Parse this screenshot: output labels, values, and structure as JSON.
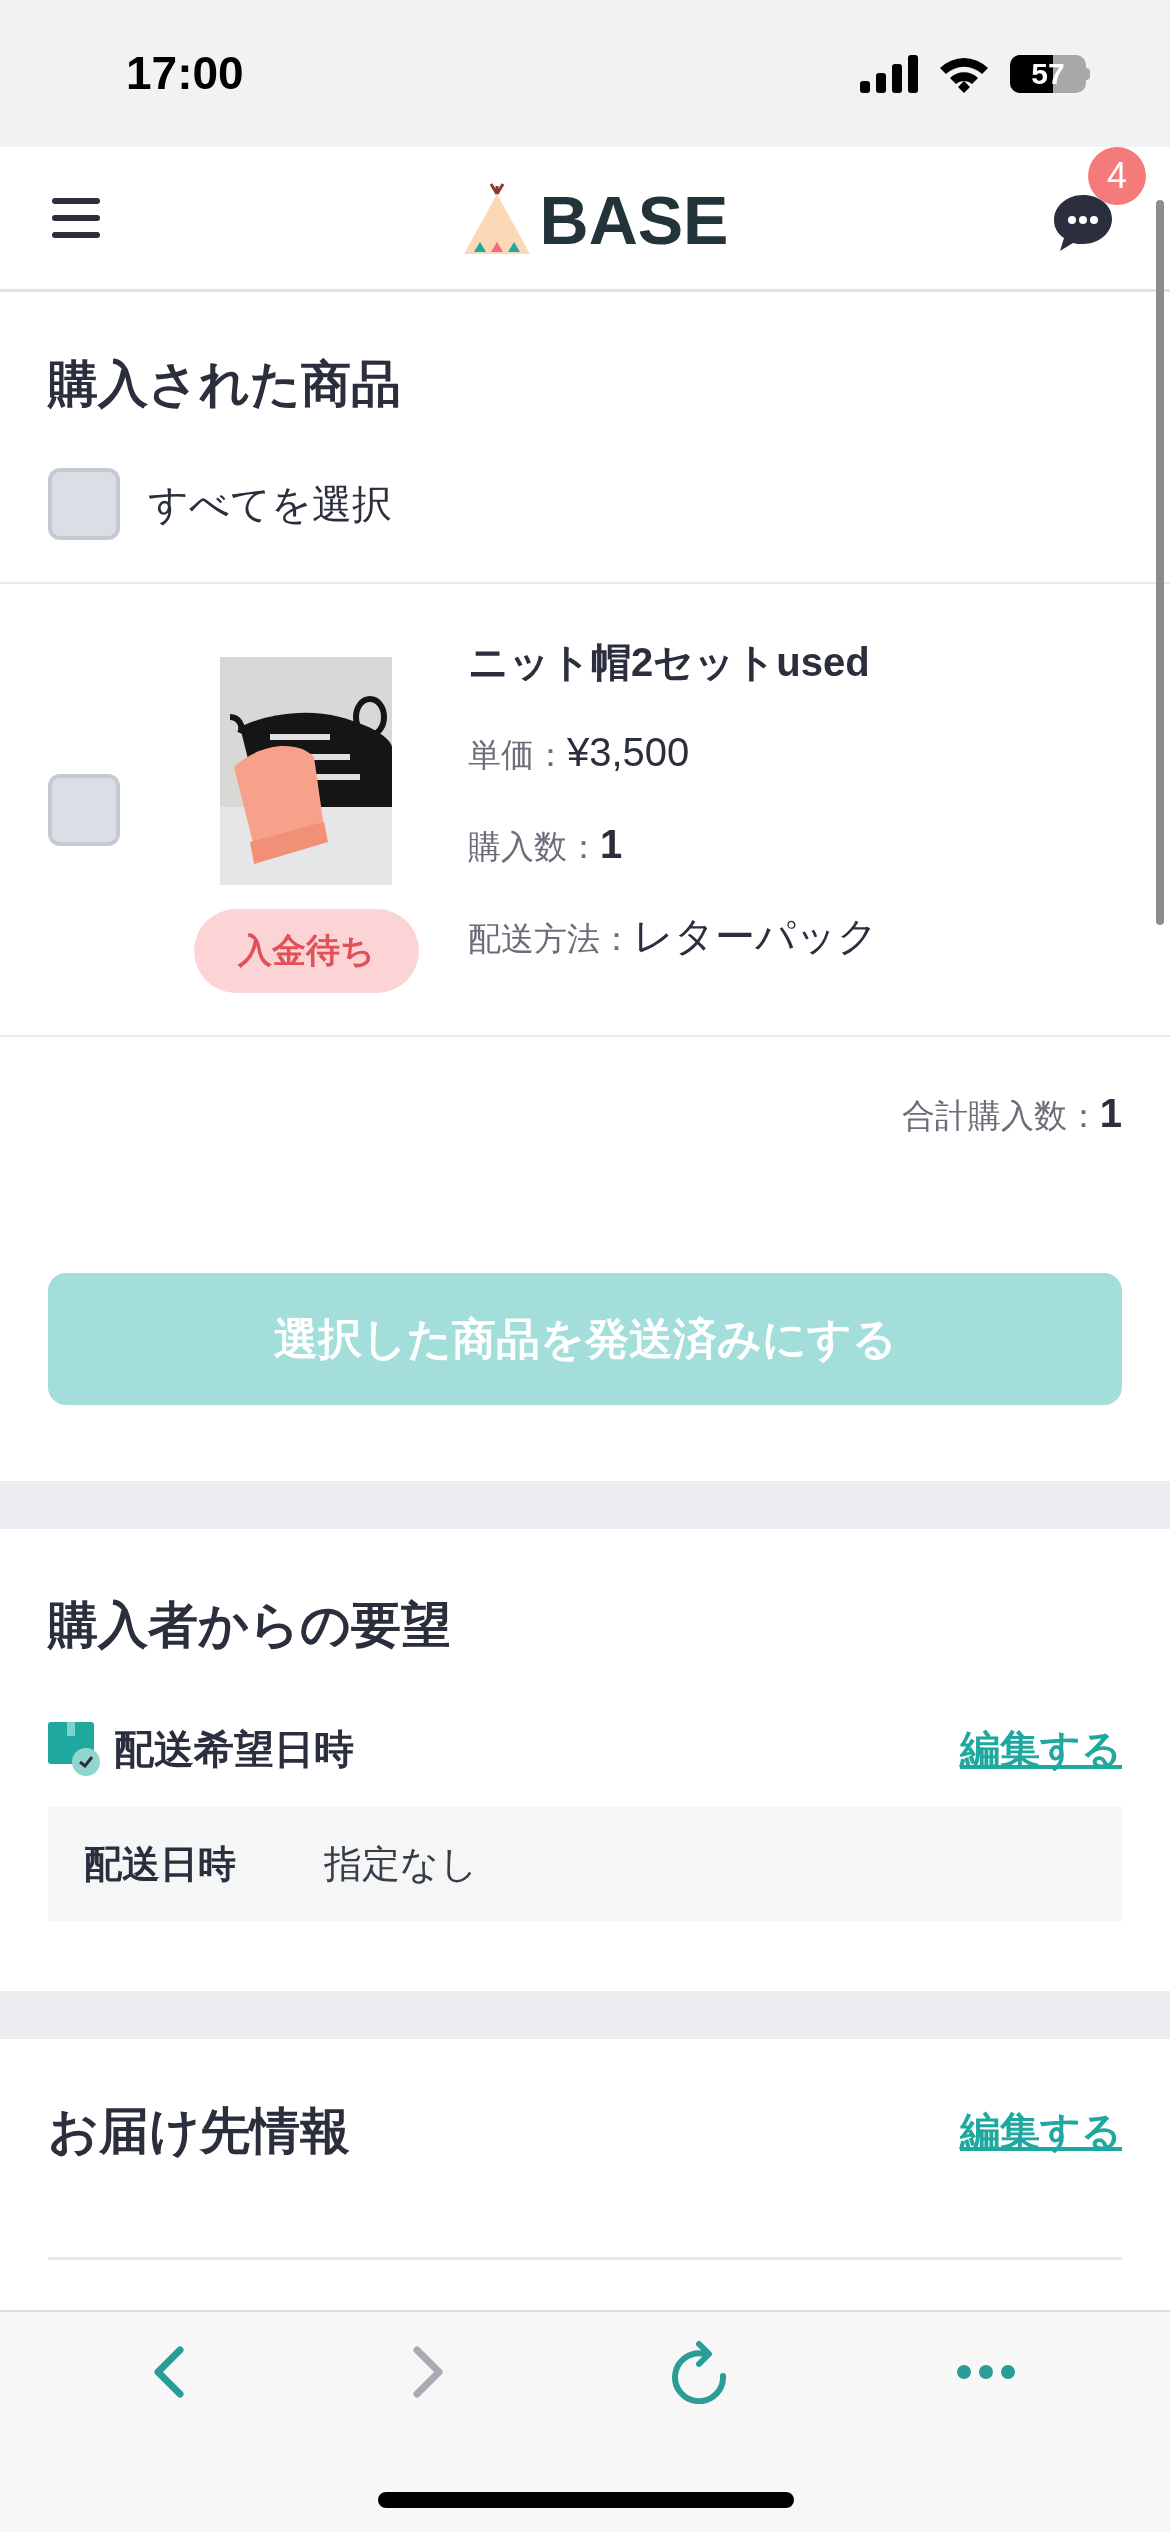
{
  "status_bar": {
    "time": "17:00",
    "battery": "57"
  },
  "header": {
    "logo": "BASE",
    "unread_badge": "4"
  },
  "purchased": {
    "title": "購入された商品",
    "select_all": {
      "label": "すべてを選択",
      "checked": false
    },
    "items": [
      {
        "checked": false,
        "status": "入金待ち",
        "name": "ニット帽2セットused",
        "fields": [
          {
            "label": "単価：",
            "value": "¥3,500",
            "bold": false
          },
          {
            "label": "購入数：",
            "value": "1",
            "bold": true
          },
          {
            "label": "配送方法：",
            "value": "レターパック",
            "bold": false
          }
        ]
      }
    ],
    "total": {
      "label": "合計購入数：",
      "value": "1"
    },
    "ship_button": {
      "label": "選択した商品を発送済みにする",
      "disabled": true
    }
  },
  "requests": {
    "title": "購入者からの要望",
    "subtitle": "配送希望日時",
    "edit": "編集する",
    "rows": [
      {
        "label": "配送日時",
        "value": "指定なし"
      }
    ]
  },
  "delivery": {
    "title": "お届け先情報",
    "edit": "編集する"
  }
}
